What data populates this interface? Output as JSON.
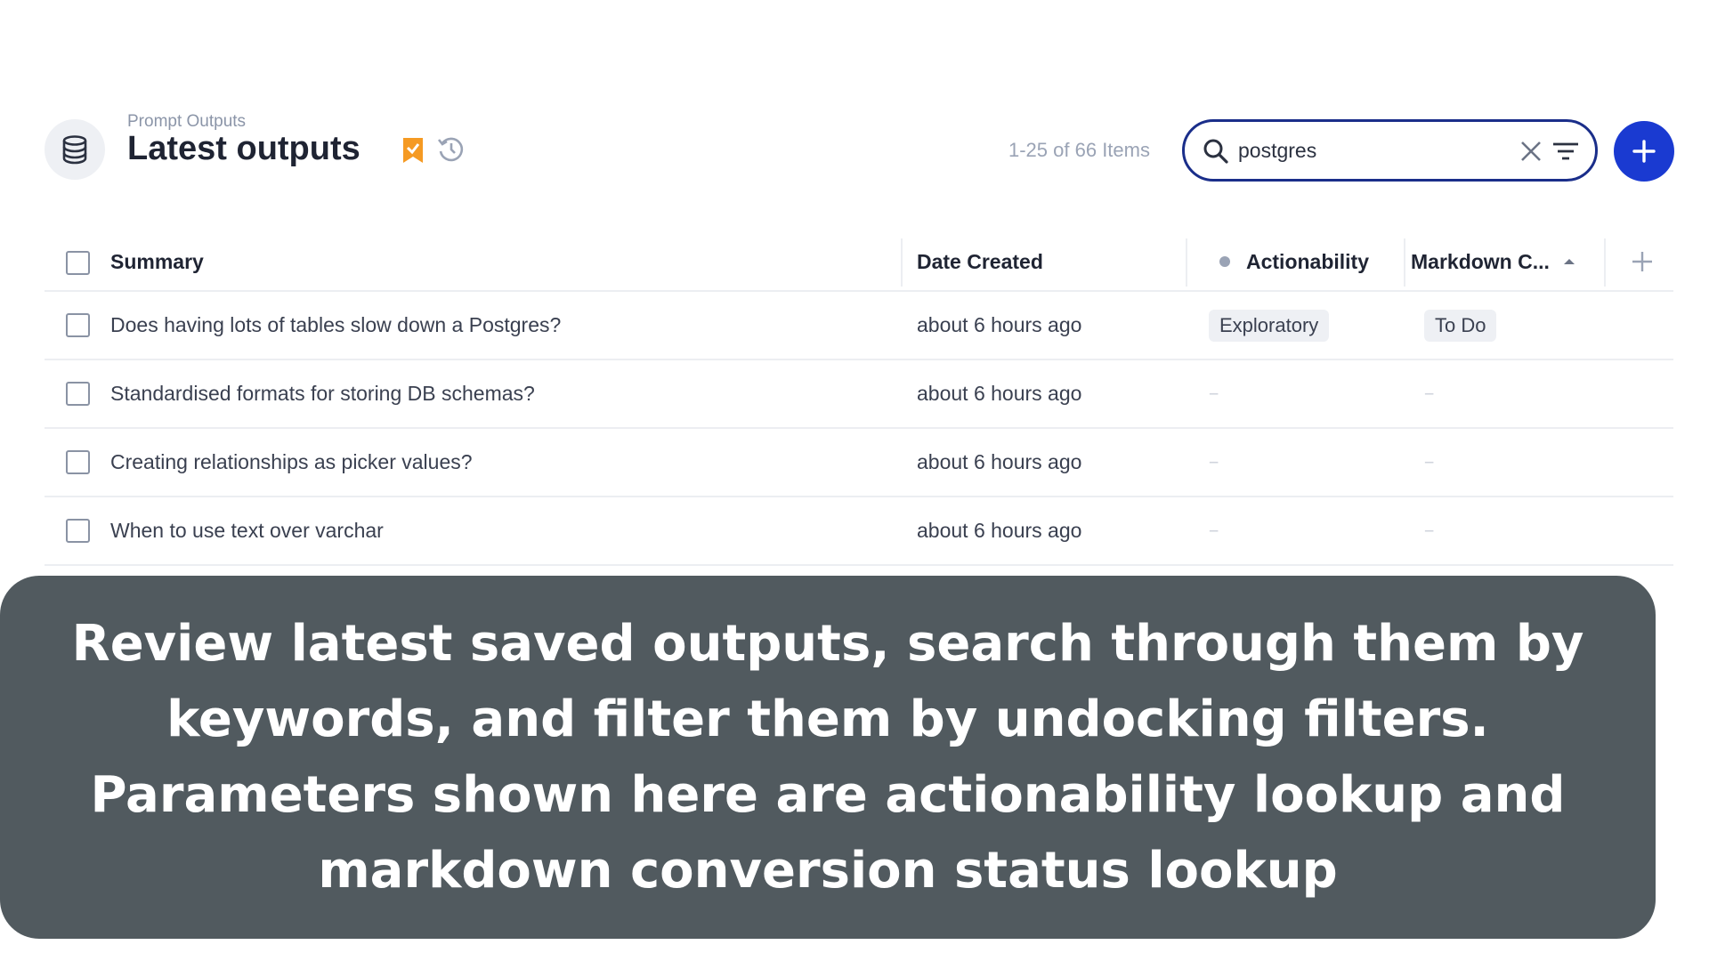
{
  "header": {
    "breadcrumb": "Prompt Outputs",
    "title": "Latest outputs",
    "item_count": "1-25 of 66 Items",
    "search_value": "postgres",
    "icons": {
      "avatar": "database-icon",
      "bookmark": "bookmark-check-icon",
      "history": "history-icon",
      "search": "search-icon",
      "clear": "close-icon",
      "filter": "filter-icon",
      "add": "plus-icon"
    }
  },
  "table": {
    "columns": [
      {
        "label": "Summary"
      },
      {
        "label": "Date Created"
      },
      {
        "label": "Actionability"
      },
      {
        "label": "Markdown C..."
      }
    ],
    "rows": [
      {
        "summary": "Does having lots of tables slow down a Postgres?",
        "date": "about 6 hours ago",
        "actionability": "Exploratory",
        "markdown": "To Do"
      },
      {
        "summary": "Standardised formats for storing DB schemas?",
        "date": "about 6 hours ago",
        "actionability": "--",
        "markdown": "--"
      },
      {
        "summary": "Creating relationships as picker values?",
        "date": "about 6 hours ago",
        "actionability": "--",
        "markdown": "--"
      },
      {
        "summary": "When to use text over varchar",
        "date": "about 6 hours ago",
        "actionability": "--",
        "markdown": "--"
      }
    ]
  },
  "caption": {
    "text": "Review latest saved outputs, search through them by keywords, and filter them by undocking filters. Parameters shown here are actionability lookup and markdown conversion status lookup"
  },
  "colors": {
    "accent": "#1a3ad1",
    "search_border": "#1a2e8a",
    "bookmark": "#f59a23",
    "caption_bg": "#515a5f"
  }
}
